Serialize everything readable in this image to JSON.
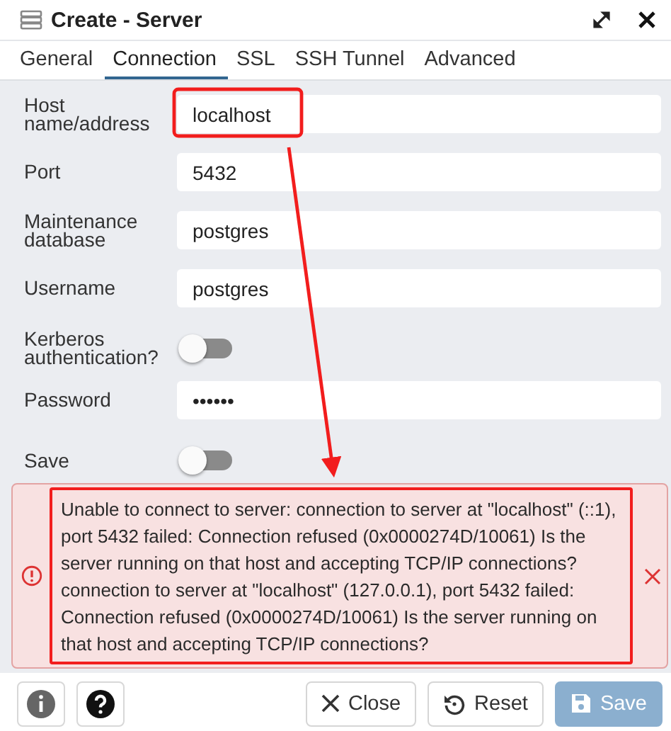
{
  "window": {
    "title": "Create - Server"
  },
  "tabs": [
    {
      "label": "General",
      "selected": false
    },
    {
      "label": "Connection",
      "selected": true
    },
    {
      "label": "SSL",
      "selected": false
    },
    {
      "label": "SSH Tunnel",
      "selected": false
    },
    {
      "label": "Advanced",
      "selected": false
    }
  ],
  "fields": [
    {
      "kind": "text",
      "label": "Host name/address",
      "value": "localhost"
    },
    {
      "kind": "text",
      "label": "Port",
      "value": "5432"
    },
    {
      "kind": "text",
      "label": "Maintenance database",
      "value": "postgres"
    },
    {
      "kind": "text",
      "label": "Username",
      "value": "postgres"
    },
    {
      "kind": "toggle",
      "label": "Kerberos authentication?",
      "on": false
    },
    {
      "kind": "text",
      "label": "Password",
      "value": "••••••"
    },
    {
      "kind": "toggle",
      "label": "Save",
      "on": false
    }
  ],
  "error": {
    "message": "Unable to connect to server: connection to server at \"localhost\" (::1), port 5432 failed: Connection refused (0x0000274D/10061) Is the server running on that host and accepting TCP/IP connections? connection to server at \"localhost\" (127.0.0.1), port 5432 failed: Connection refused (0x0000274D/10061) Is the server running on that host and accepting TCP/IP connections?"
  },
  "footer": {
    "close_label": "Close",
    "reset_label": "Reset",
    "save_label": "Save",
    "save_disabled": true
  }
}
